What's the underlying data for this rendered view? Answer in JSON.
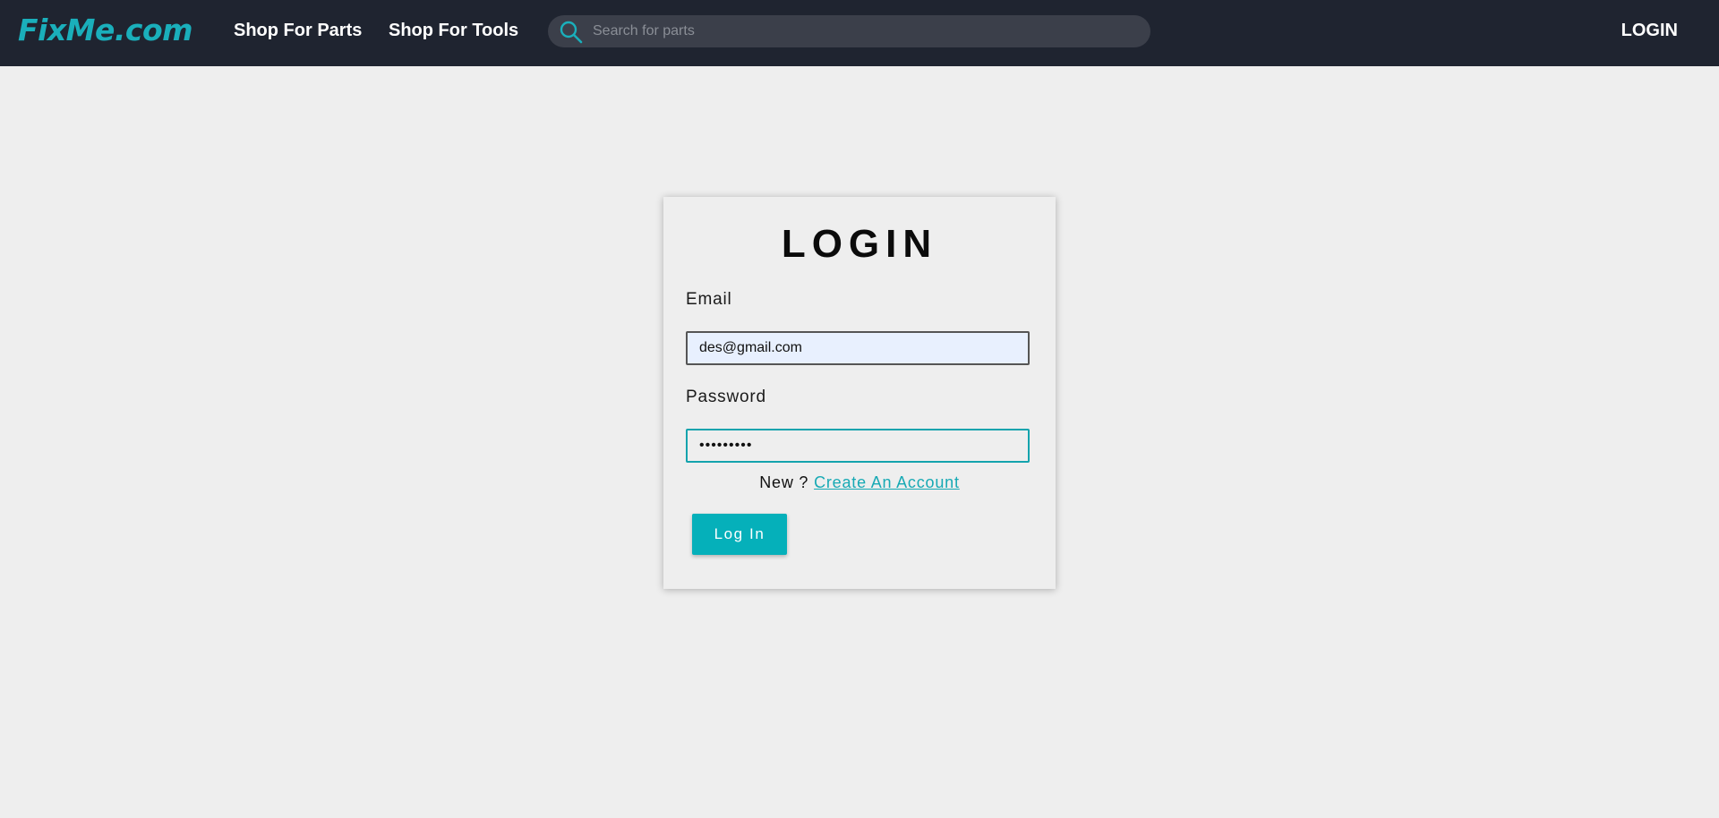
{
  "header": {
    "logo": "FixMe.com",
    "nav": {
      "shop_parts": "Shop For Parts",
      "shop_tools": "Shop For Tools",
      "login": "LOGIN"
    },
    "search": {
      "placeholder": "Search for parts",
      "icon": "search-icon"
    }
  },
  "login_form": {
    "title": "LOGIN",
    "email_label": "Email",
    "email_value": "des@gmail.com",
    "password_label": "Password",
    "password_value": "•••••••••",
    "signup_prompt": "New ?",
    "signup_link": "Create An Account",
    "submit_label": "Log In"
  },
  "colors": {
    "navbar_bg": "#1f2430",
    "accent": "#05b0ba",
    "page_bg": "#eeeeee",
    "email_field_bg": "#e8f0fe"
  }
}
